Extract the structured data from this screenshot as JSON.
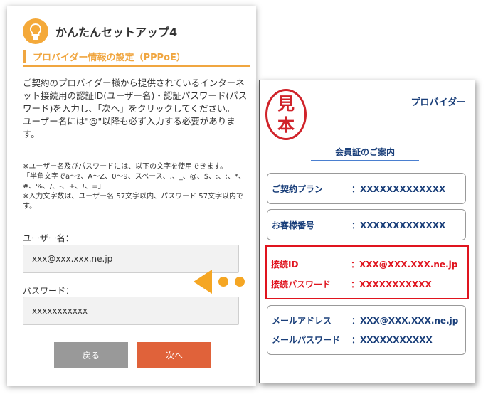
{
  "setup": {
    "title": "かんたんセットアップ4",
    "section": "プロバイダー情報の設定（PPPoE）",
    "desc1": "ご契約のプロバイダー様から提供されているインターネット接続用の認証ID(ユーザー名)・認証パスワード(パスワード)を入力し、「次へ」をクリックしてください。",
    "desc2": "ユーザー名には\"@\"以降も必ず入力する必要があります。",
    "note1": "※ユーザー名及びパスワードには、以下の文字を使用できます。",
    "note2": "「半角文字でa～z、A～Z、0～9、スペース、.、_、@、$、:、;、*、#、%、/、-、+、!、=」",
    "note3": "※入力文字数は、ユーザー名 57文字以内、パスワード 57文字以内です。",
    "username_label": "ユーザー名：",
    "username_value": "xxx@xxx.xxx.ne.jp",
    "password_label": "パスワード：",
    "password_value": "xxxxxxxxxxx",
    "back_label": "戻る",
    "next_label": "次へ"
  },
  "card": {
    "stamp": [
      "見",
      "本"
    ],
    "provider": "プロバイダー",
    "title": "会員証のご案内",
    "plan_key": "ご契約プラン",
    "plan_val": "：XXXXXXXXXXXXX",
    "customer_key": "お客様番号",
    "customer_val": "：XXXXXXXXXXXXX",
    "conn_id_key": "接続ID",
    "conn_id_val": "：XXX@XXX.XXX.ne.jp",
    "conn_pw_key": "接続パスワード",
    "conn_pw_val": "：XXXXXXXXXXX",
    "mail_key": "メールアドレス",
    "mail_val": "：XXX@XXX.XXX.ne.jp",
    "mailpw_key": "メールパスワード",
    "mailpw_val": "：XXXXXXXXXXX"
  },
  "colors": {
    "accent": "#f0a640",
    "next": "#e0623a",
    "highlight": "#e0141e",
    "navy": "#1a3f7a"
  },
  "icons": {
    "header": "lightbulb-icon",
    "pointer": "arrow-left-icon"
  }
}
